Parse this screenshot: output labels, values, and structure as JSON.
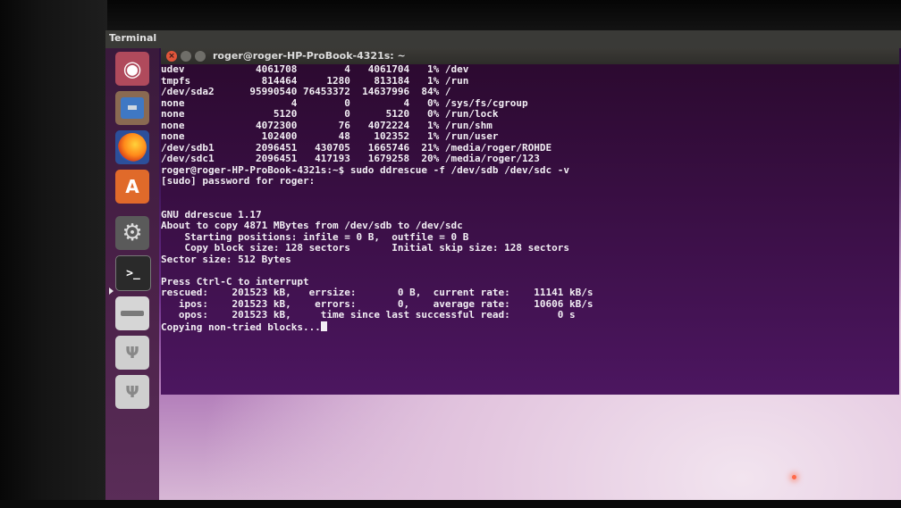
{
  "top_panel": {
    "title": "Terminal"
  },
  "launcher": {
    "items": [
      {
        "name": "dash-icon",
        "glyph": "◉"
      },
      {
        "name": "files-icon"
      },
      {
        "name": "firefox-icon"
      },
      {
        "name": "software-center-icon",
        "glyph": "A"
      },
      {
        "name": "system-settings-icon",
        "glyph": "⚙"
      },
      {
        "name": "terminal-icon",
        "glyph": ">_"
      },
      {
        "name": "disk-icon"
      },
      {
        "name": "usb-drive-icon",
        "glyph": "Ψ"
      },
      {
        "name": "usb-drive-icon",
        "glyph": "Ψ"
      }
    ]
  },
  "terminal": {
    "title": "roger@roger-HP-ProBook-4321s: ~",
    "df_rows": [
      "udev            4061708        4   4061704   1% /dev",
      "tmpfs            814464     1280    813184   1% /run",
      "/dev/sda2      95990540 76453372  14637996  84% /",
      "none                  4        0         4   0% /sys/fs/cgroup",
      "none               5120        0      5120   0% /run/lock",
      "none            4072300       76   4072224   1% /run/shm",
      "none             102400       48    102352   1% /run/user",
      "/dev/sdb1       2096451   430705   1665746  21% /media/roger/ROHDE",
      "/dev/sdc1       2096451   417193   1679258  20% /media/roger/123"
    ],
    "command_line": "roger@roger-HP-ProBook-4321s:~$ sudo ddrescue -f /dev/sdb /dev/sdc -v",
    "password_prompt": "[sudo] password for roger:",
    "ddrescue_header": [
      "GNU ddrescue 1.17",
      "About to copy 4871 MBytes from /dev/sdb to /dev/sdc",
      "    Starting positions: infile = 0 B,  outfile = 0 B",
      "    Copy block size: 128 sectors       Initial skip size: 128 sectors",
      "Sector size: 512 Bytes"
    ],
    "status_lines": [
      "Press Ctrl-C to interrupt",
      "rescued:    201523 kB,   errsize:       0 B,  current rate:    11141 kB/s",
      "   ipos:    201523 kB,    errors:       0,    average rate:    10606 kB/s",
      "   opos:    201523 kB,     time since last successful read:        0 s",
      "Copying non-tried blocks..."
    ]
  }
}
